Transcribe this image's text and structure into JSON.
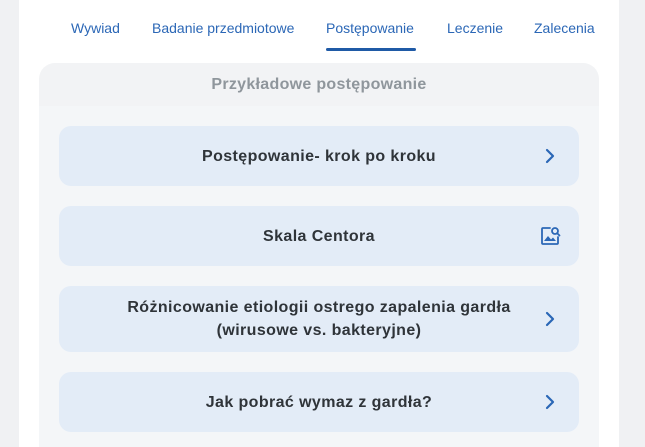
{
  "tabs": [
    {
      "label": "Wywiad"
    },
    {
      "label": "Badanie przedmiotowe"
    },
    {
      "label": "Postępowanie",
      "active": true
    },
    {
      "label": "Leczenie"
    },
    {
      "label": "Zalecenia"
    }
  ],
  "section": {
    "title": "Przykładowe postępowanie",
    "items": [
      {
        "label": "Postępowanie- krok po kroku",
        "icon": "chevron-right-icon"
      },
      {
        "label": "Skala Centora",
        "icon": "image-search-icon"
      },
      {
        "label": "Różnicowanie etiologii ostrego zapalenia gardła (wirusowe vs. bakteryjne)",
        "icon": "chevron-right-icon"
      },
      {
        "label": "Jak pobrać wymaz z gardła?",
        "icon": "chevron-right-icon"
      }
    ]
  },
  "colors": {
    "accent": "#2b67b6",
    "item_background": "#e3ecf7",
    "title_gray": "#8f969c"
  }
}
